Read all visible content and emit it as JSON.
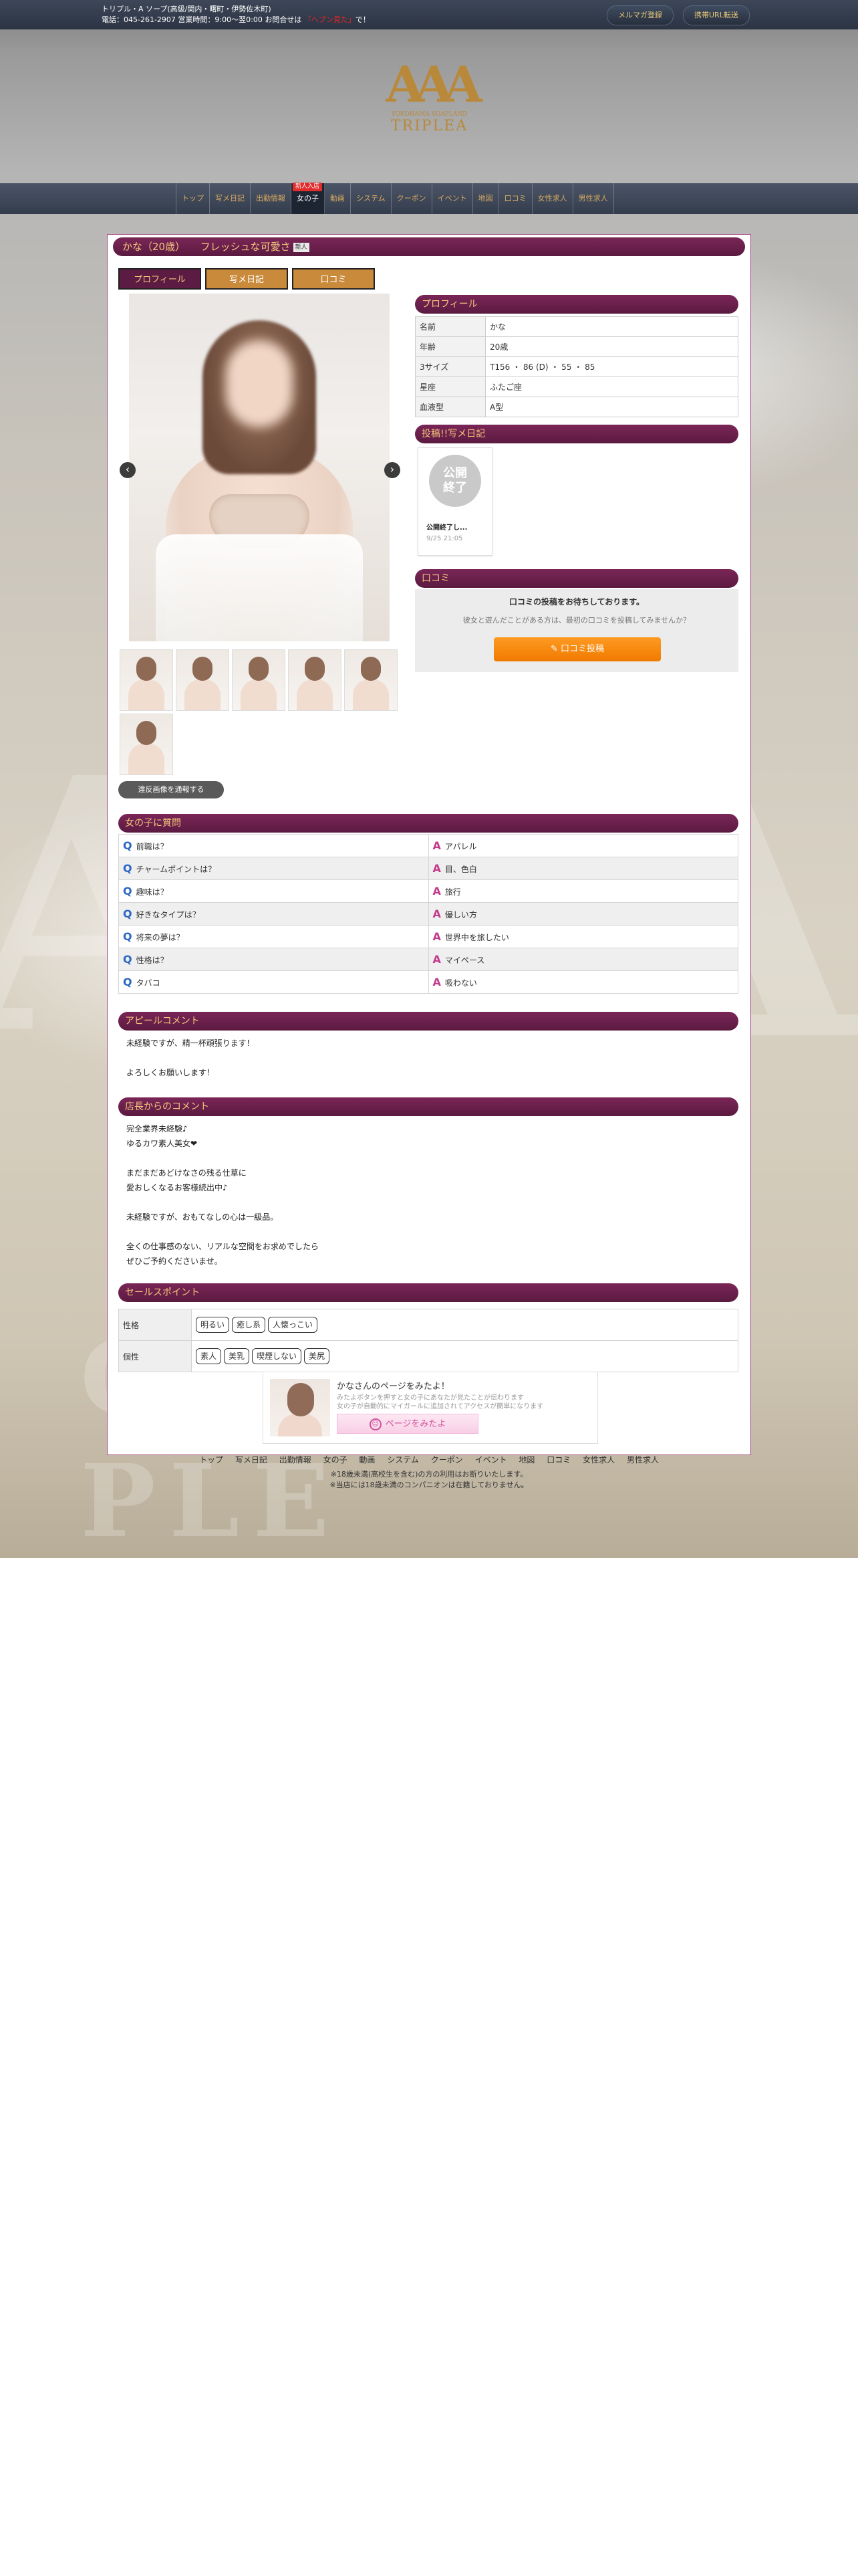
{
  "topbar": {
    "line1": "トリプル・A ソープ(高級/関内・曙町・伊勢佐木町)",
    "line2_prefix": "電話：045-261-2907 営業時間：9:00〜翌0:00 お問合せは",
    "line2_red": "「ヘブン見た」",
    "line2_suffix": "で！",
    "btn_mail": "メルマガ登録",
    "btn_mobile": "携帯URL転送"
  },
  "logo": {
    "mark": "AAA",
    "sub": "YOKOHAMA SOAPLAND",
    "name": "TRIPLEA"
  },
  "nav": {
    "items": [
      "トップ",
      "写メ日記",
      "出勤情報",
      "女の子",
      "動画",
      "システム",
      "クーポン",
      "イベント",
      "地図",
      "口コミ",
      "女性求人",
      "男性求人"
    ],
    "active_index": 3,
    "new_badge": "新人入店"
  },
  "profile_header": {
    "title": "かな（20歳）　　フレッシュな可愛さ",
    "tag": "新人"
  },
  "tabs": [
    "プロフィール",
    "写メ日記",
    "口コミ"
  ],
  "gallery": {
    "prev": "‹",
    "next": "›",
    "report_button": "違反画像を通報する"
  },
  "profile": {
    "heading": "プロフィール",
    "rows": [
      {
        "k": "名前",
        "v": "かな"
      },
      {
        "k": "年齢",
        "v": "20歳"
      },
      {
        "k": "3サイズ",
        "v": "T156 ・ 86 (D) ・ 55 ・ 85"
      },
      {
        "k": "星座",
        "v": "ふたご座"
      },
      {
        "k": "血液型",
        "v": "A型"
      }
    ]
  },
  "diary": {
    "heading": "投稿!!写メ日記",
    "badge_line1": "公開",
    "badge_line2": "終了",
    "title": "公開終了し...",
    "date": "9/25 21:05"
  },
  "kuchikomi": {
    "heading": "口コミ",
    "line1": "口コミの投稿をお待ちしております。",
    "line2": "彼女と遊んだことがある方は、最初の口コミを投稿してみませんか？",
    "button": "✎ 口コミ投稿"
  },
  "qa": {
    "heading": "女の子に質問",
    "q_mark": "Q",
    "a_mark": "A",
    "rows": [
      {
        "q": "前職は？",
        "a": "アパレル"
      },
      {
        "q": "チャームポイントは？",
        "a": "目、色白"
      },
      {
        "q": "趣味は？",
        "a": "旅行"
      },
      {
        "q": "好きなタイプは？",
        "a": "優しい方"
      },
      {
        "q": "将来の夢は？",
        "a": "世界中を旅したい"
      },
      {
        "q": "性格は？",
        "a": "マイペース"
      },
      {
        "q": "タバコ",
        "a": "吸わない"
      }
    ]
  },
  "appeal": {
    "heading": "アピールコメント",
    "text": "未経験ですが、精一杯頑張ります！\n\nよろしくお願いします！"
  },
  "manager": {
    "heading": "店長からのコメント",
    "text": "完全業界未経験♪\nゆるカワ素人美女❤\n\nまだまだあどけなさの残る仕草に\n愛おしくなるお客様続出中♪\n\n未経験ですが、おもてなしの心は一級品。\n\n全くの仕事感のない、リアルな空間をお求めでしたら\nぜひご予約くださいませ。"
  },
  "sales": {
    "heading": "セールスポイント",
    "rows": [
      {
        "k": "性格",
        "tags": [
          "明るい",
          "癒し系",
          "人懐っこい"
        ]
      },
      {
        "k": "個性",
        "tags": [
          "素人",
          "美乳",
          "喫煙しない",
          "美尻"
        ]
      }
    ]
  },
  "promo": {
    "title": "かなさんのページをみたよ！",
    "desc": "みたよボタンを押すと女の子にあなたが見たことが伝わります\n女の子が自動的にマイガールに追加されてアクセスが簡単になります",
    "button": "ページをみたよ"
  },
  "footer": {
    "nav": [
      "トップ",
      "写メ日記",
      "出勤情報",
      "女の子",
      "動画",
      "システム",
      "クーポン",
      "イベント",
      "地図",
      "口コミ",
      "女性求人",
      "男性求人"
    ],
    "note1": "※18歳未満(高校生を含む)の方の利用はお断りいたします。",
    "note2": "※当店には18歳未満のコンパニオンは在籍しておりません。"
  }
}
